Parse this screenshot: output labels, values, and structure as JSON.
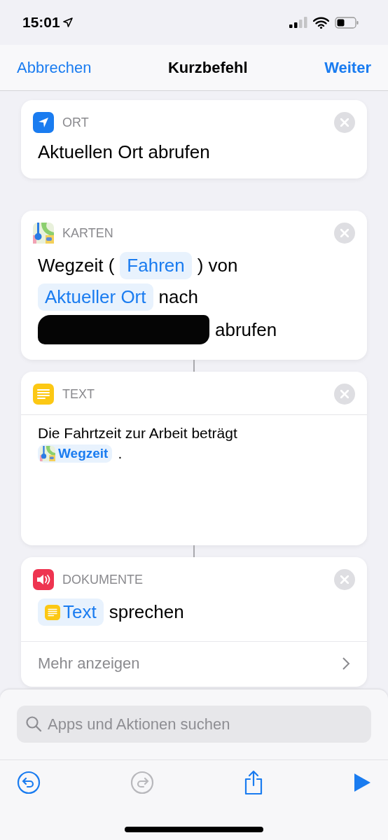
{
  "status_bar": {
    "time": "15:01"
  },
  "nav": {
    "cancel": "Abbrechen",
    "title": "Kurzbefehl",
    "next": "Weiter"
  },
  "actions": [
    {
      "app": "ORT",
      "kind": "location",
      "linked_to_previous": false,
      "lines": [
        [
          {
            "kind": "text",
            "text": "Aktuellen Ort abrufen"
          }
        ]
      ]
    },
    {
      "app": "KARTEN",
      "kind": "maps",
      "linked_to_previous": false,
      "lines": [
        [
          {
            "kind": "text",
            "text": "Wegzeit ("
          },
          {
            "kind": "chip",
            "text": "Fahren"
          },
          {
            "kind": "text",
            "text": ") von"
          }
        ],
        [
          {
            "kind": "chip",
            "text": "Aktueller Ort"
          },
          {
            "kind": "text",
            "text": "nach"
          }
        ],
        [
          {
            "kind": "redacted"
          },
          {
            "kind": "text",
            "text": "abrufen"
          }
        ]
      ]
    },
    {
      "app": "TEXT",
      "kind": "text",
      "linked_to_previous": true,
      "lines": [
        [
          {
            "kind": "text",
            "text": "Die Fahrtzeit zur Arbeit beträgt"
          }
        ],
        [
          {
            "kind": "maps_chip",
            "text": "Wegzeit"
          },
          {
            "kind": "text",
            "text": "."
          }
        ]
      ]
    },
    {
      "app": "DOKUMENTE",
      "kind": "speak",
      "linked_to_previous": true,
      "more": "Mehr anzeigen",
      "lines": [
        [
          {
            "kind": "text_chip",
            "text": "Text"
          },
          {
            "kind": "text",
            "text": "sprechen"
          }
        ]
      ]
    }
  ],
  "search": {
    "placeholder": "Apps und Aktionen suchen"
  },
  "toolbar": [
    {
      "kind": "undo",
      "disabled": false
    },
    {
      "kind": "redo",
      "disabled": true
    },
    {
      "kind": "share",
      "disabled": false
    },
    {
      "kind": "run",
      "disabled": false
    }
  ]
}
